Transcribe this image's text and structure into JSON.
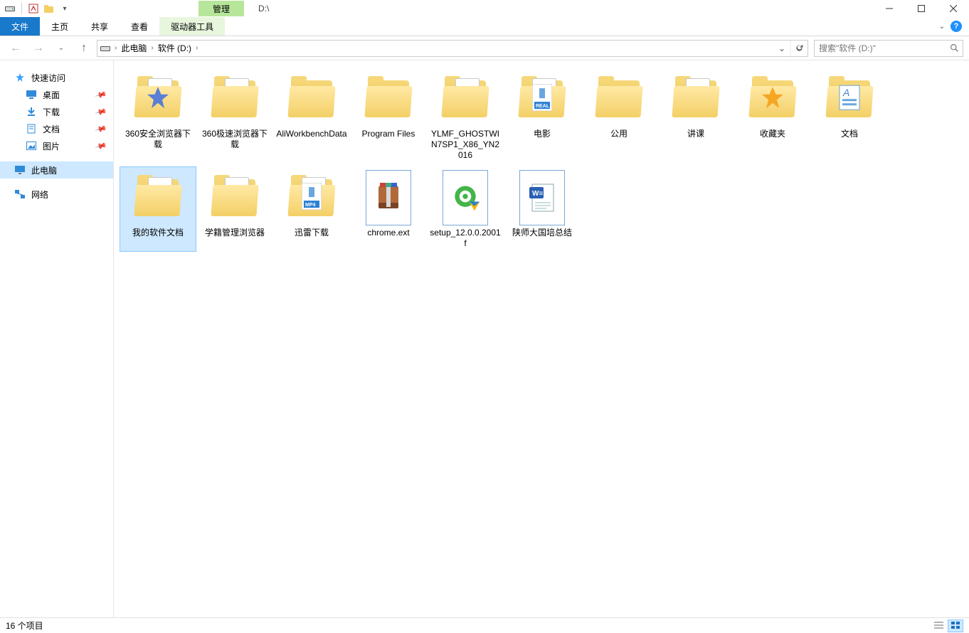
{
  "titlebar": {
    "context_label": "管理",
    "path_text": "D:\\"
  },
  "ribbon": {
    "file": "文件",
    "tabs": [
      "主页",
      "共享",
      "查看"
    ],
    "context_tab": "驱动器工具"
  },
  "nav": {
    "breadcrumbs": [
      "此电脑",
      "软件 (D:)"
    ]
  },
  "search": {
    "placeholder": "搜索\"软件 (D:)\""
  },
  "sidebar": {
    "quick_access": "快速访问",
    "children": [
      {
        "label": "桌面",
        "icon": "desktop"
      },
      {
        "label": "下载",
        "icon": "download"
      },
      {
        "label": "文档",
        "icon": "document"
      },
      {
        "label": "图片",
        "icon": "picture"
      }
    ],
    "this_pc": "此电脑",
    "network": "网络"
  },
  "items": [
    {
      "label": "360安全浏览器下载",
      "kind": "folder-star"
    },
    {
      "label": "360极速浏览器下载",
      "kind": "folder-paper"
    },
    {
      "label": "AliWorkbenchData",
      "kind": "folder"
    },
    {
      "label": "Program Files",
      "kind": "folder"
    },
    {
      "label": "YLMF_GHOSTWIN7SP1_X86_YN2016",
      "kind": "folder-paper"
    },
    {
      "label": "电影",
      "kind": "folder-real"
    },
    {
      "label": "公用",
      "kind": "folder"
    },
    {
      "label": "讲课",
      "kind": "folder-paper"
    },
    {
      "label": "收藏夹",
      "kind": "folder-favstar"
    },
    {
      "label": "文档",
      "kind": "folder-doc"
    },
    {
      "label": "我的软件文档",
      "kind": "folder-paper",
      "selected": true
    },
    {
      "label": "学籍管理浏览器",
      "kind": "folder-paper"
    },
    {
      "label": "迅雷下载",
      "kind": "folder-mp4"
    },
    {
      "label": "chrome.ext",
      "kind": "file-rar"
    },
    {
      "label": "setup_12.0.0.2001f",
      "kind": "file-setup"
    },
    {
      "label": "陕师大国培总结",
      "kind": "file-word"
    }
  ],
  "status": {
    "count_text": "16 个项目"
  }
}
